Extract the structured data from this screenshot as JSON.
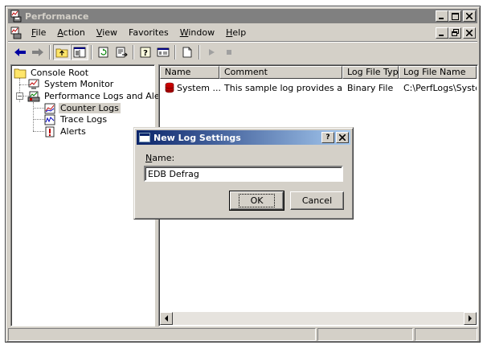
{
  "window": {
    "title": "Performance",
    "caption_buttons": [
      "_",
      "□",
      "X"
    ]
  },
  "menubar": {
    "items": [
      {
        "label": "File",
        "accel": "F",
        "rest": "ile"
      },
      {
        "label": "Action",
        "accel": "A",
        "rest": "ction"
      },
      {
        "label": "View",
        "accel": "V",
        "rest": "iew"
      },
      {
        "label": "Favorites",
        "accel": "",
        "rest": "Favorites"
      },
      {
        "label": "Window",
        "accel": "W",
        "rest": "indow"
      },
      {
        "label": "Help",
        "accel": "H",
        "rest": "elp"
      }
    ],
    "mdi_buttons": [
      "_",
      "▫",
      "X"
    ]
  },
  "toolbar": {
    "icons": [
      "back-icon",
      "forward-icon",
      "up-folder-icon",
      "show-hide-tree-icon",
      "refresh-icon",
      "export-list-icon",
      "help-icon",
      "properties-icon",
      "new-log-icon",
      "start-icon",
      "stop-icon"
    ]
  },
  "tree": {
    "items": [
      {
        "label": "Console Root",
        "icon": "folder-icon"
      },
      {
        "label": "System Monitor",
        "icon": "system-monitor-icon"
      },
      {
        "label": "Performance Logs and Alerts",
        "icon": "perf-logs-icon"
      },
      {
        "label": "Counter Logs",
        "icon": "counter-logs-icon",
        "selected": true
      },
      {
        "label": "Trace Logs",
        "icon": "trace-logs-icon"
      },
      {
        "label": "Alerts",
        "icon": "alerts-icon"
      }
    ]
  },
  "list": {
    "columns": [
      "Name",
      "Comment",
      "Log File Type",
      "Log File Name"
    ],
    "rows": [
      {
        "name": "System ...",
        "comment": "This sample log provides an o...",
        "type": "Binary File",
        "file": "C:\\PerfLogs\\System..."
      }
    ]
  },
  "dialog": {
    "title": "New Log Settings",
    "help_button": "?",
    "close_button": "X",
    "name_label_accel": "N",
    "name_label_rest": "ame:",
    "name_value": "EDB Defrag",
    "ok_label": "OK",
    "cancel_label": "Cancel"
  },
  "colors": {
    "dialog_title_start": "#0a246a",
    "dialog_title_end": "#a6caf0",
    "chrome": "#d4d0c8",
    "inactive_title": "#808080"
  }
}
